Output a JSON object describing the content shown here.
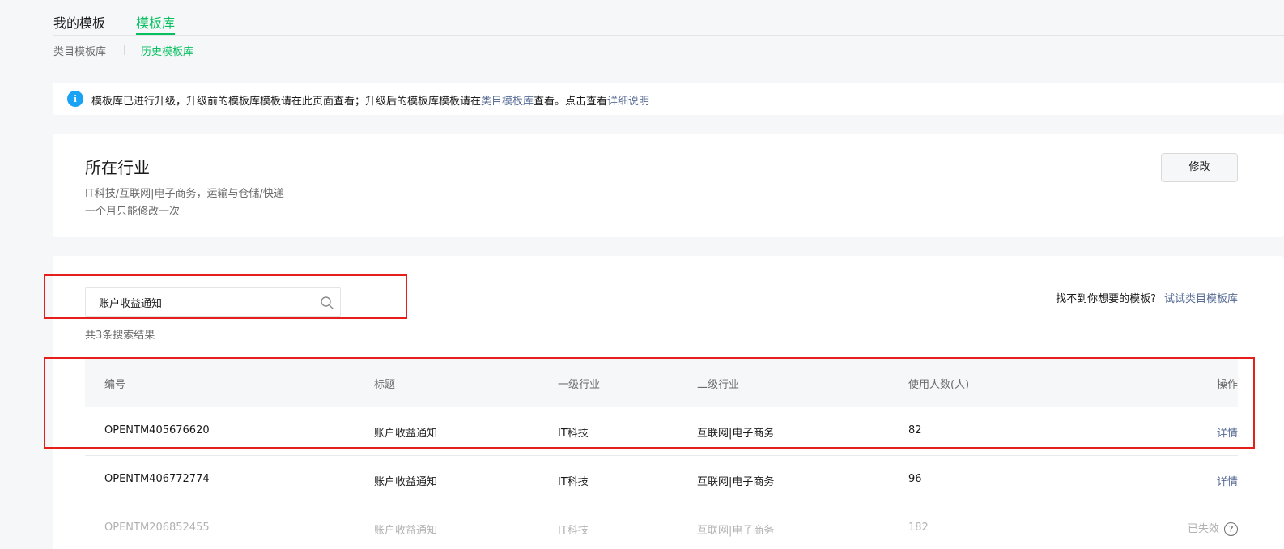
{
  "tabs": [
    {
      "label": "我的模板"
    },
    {
      "label": "模板库"
    }
  ],
  "subtabs": [
    {
      "label": "类目模板库"
    },
    {
      "label": "历史模板库"
    }
  ],
  "banner": {
    "text_before": "模板库已进行升级，升级前的模板库模板请在此页面查看；升级后的模板库模板请在",
    "link1": "类目模板库",
    "text_middle": "查看。点击查看",
    "link2": "详细说明"
  },
  "industry": {
    "title": "所在行业",
    "value": "IT科技/互联网|电子商务，运输与仓储/快递",
    "note": "一个月只能修改一次",
    "modify_label": "修改"
  },
  "search": {
    "value": "账户收益通知",
    "result_count": "共3条搜索结果",
    "hint": "找不到你想要的模板?",
    "hint_link": "试试类目模板库"
  },
  "table": {
    "headers": [
      "编号",
      "标题",
      "一级行业",
      "二级行业",
      "使用人数(人)",
      "操作"
    ],
    "rows": [
      {
        "id": "OPENTM405676620",
        "title": "账户收益通知",
        "industry1": "IT科技",
        "industry2": "互联网|电子商务",
        "users": "82",
        "action": "详情"
      },
      {
        "id": "OPENTM406772774",
        "title": "账户收益通知",
        "industry1": "IT科技",
        "industry2": "互联网|电子商务",
        "users": "96",
        "action": "详情"
      },
      {
        "id": "OPENTM206852455",
        "title": "账户收益通知",
        "industry1": "IT科技",
        "industry2": "互联网|电子商务",
        "users": "182",
        "action": "已失效"
      }
    ]
  },
  "colors": {
    "accent": "#07c160",
    "link": "#576b95",
    "annotation": "#e5201c"
  }
}
